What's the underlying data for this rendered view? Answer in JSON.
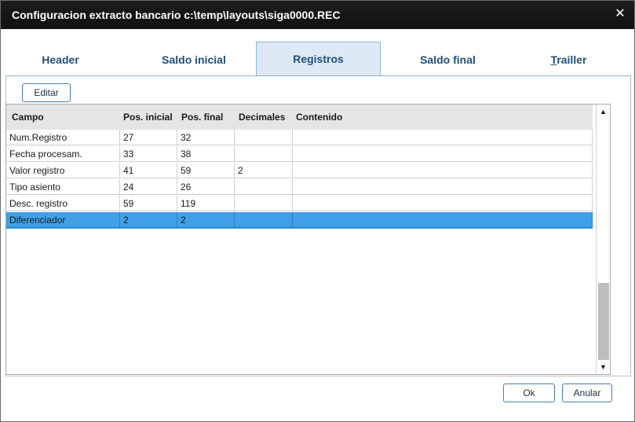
{
  "window": {
    "title": "Configuracion extracto bancario c:\\temp\\layouts\\siga0000.REC",
    "close_glyph": "✕"
  },
  "tabs": [
    {
      "label": "Header",
      "active": false
    },
    {
      "label": "Saldo inicial",
      "active": false
    },
    {
      "label": "Registros",
      "active": true
    },
    {
      "label": "Saldo final",
      "active": false
    },
    {
      "label_prefix": "T",
      "label_rest": "railler",
      "active": false
    }
  ],
  "toolbar": {
    "edit_label": "Editar"
  },
  "grid": {
    "columns": [
      "Campo",
      "Pos. inicial",
      "Pos. final",
      "Decimales",
      "Contenido"
    ],
    "rows": [
      [
        "Num.Registro",
        "27",
        "32",
        "",
        ""
      ],
      [
        "Fecha procesam.",
        "33",
        "38",
        "",
        ""
      ],
      [
        "Valor registro",
        "41",
        "59",
        "2",
        ""
      ],
      [
        "Tipo asiento",
        "24",
        "26",
        "",
        ""
      ],
      [
        "Desc. registro",
        "59",
        "119",
        "",
        ""
      ],
      [
        "Diferenciador",
        "2",
        "2",
        "",
        ""
      ]
    ],
    "selected_row": 5
  },
  "scrollbar": {
    "up_glyph": "▲",
    "down_glyph": "▼"
  },
  "footer": {
    "ok_label": "Ok",
    "cancel_label": "Anular"
  },
  "colors": {
    "title_bar": "#141414",
    "active_tab": "#dde9f5",
    "selection": "#3fa0e8",
    "tab_text": "#1f4f7a"
  }
}
